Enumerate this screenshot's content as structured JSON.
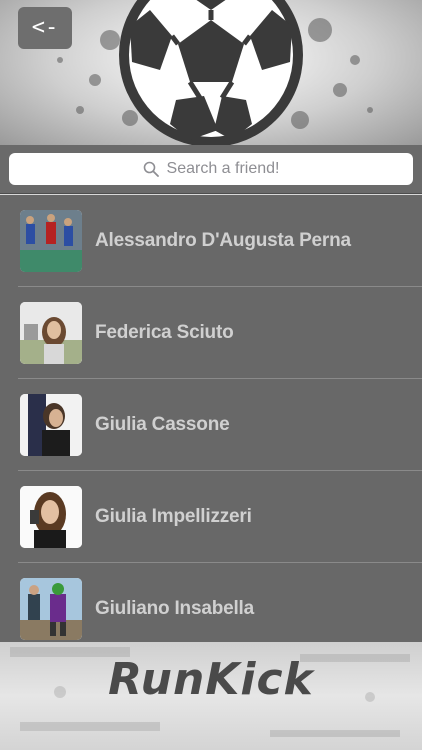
{
  "header": {
    "back_label": "<-",
    "ball_icon": "soccer-ball-icon"
  },
  "search": {
    "placeholder": "Search a friend!",
    "icon": "search-icon"
  },
  "friends": [
    {
      "name": "Alessandro D'Augusta Perna"
    },
    {
      "name": "Federica Sciuto"
    },
    {
      "name": "Giulia Cassone"
    },
    {
      "name": "Giulia Impellizzeri"
    },
    {
      "name": "Giuliano Insabella"
    }
  ],
  "footer": {
    "logo_text": "RunKick"
  },
  "colors": {
    "list_bg": "#686868",
    "name_text": "#d0d0d0",
    "logo": "#4a4a4a"
  }
}
